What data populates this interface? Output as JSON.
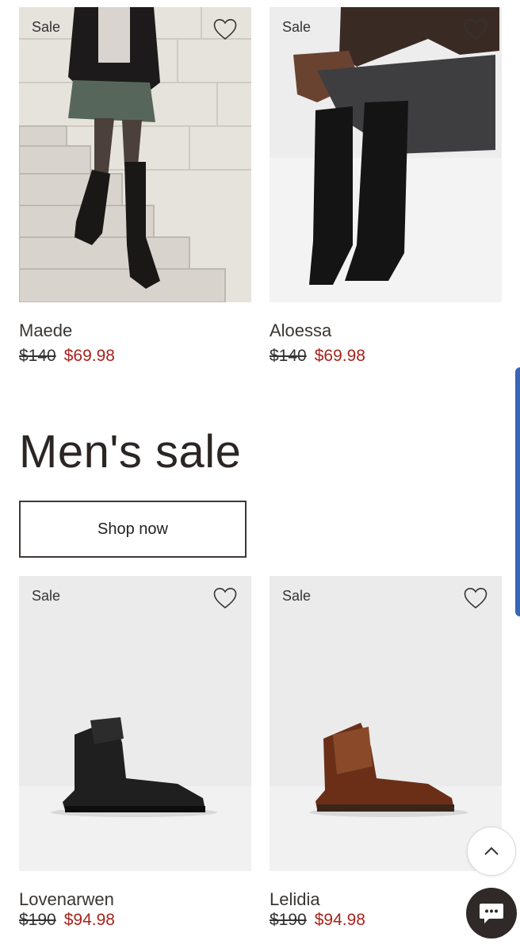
{
  "products_women": [
    {
      "badge": "Sale",
      "name": "Maede",
      "old_price": "$140",
      "new_price": "$69.98",
      "image": "woman-over-knee-boots-on-stairs"
    },
    {
      "badge": "Sale",
      "name": "Aloessa",
      "old_price": "$140",
      "new_price": "$69.98",
      "image": "black-suede-tall-boots-seated"
    }
  ],
  "mens_section": {
    "title": "Men's sale",
    "cta_label": "Shop now"
  },
  "products_men": [
    {
      "badge": "Sale",
      "name": "Lovenarwen",
      "old_price": "$190",
      "new_price": "$94.98",
      "image": "black-lace-up-boot"
    },
    {
      "badge": "Sale",
      "name": "Lelidia",
      "old_price": "$190",
      "new_price": "$94.98",
      "image": "brown-leather-lace-up-boot"
    }
  ],
  "icons": {
    "wishlist": "heart-outline-icon",
    "back_to_top": "chevron-up-icon",
    "chat": "chat-bubble-icon"
  },
  "colors": {
    "sale_price": "#a8231c",
    "text": "#2b2523",
    "chat_button": "#2f2a27",
    "scroll_indicator": "#3a66b8"
  }
}
